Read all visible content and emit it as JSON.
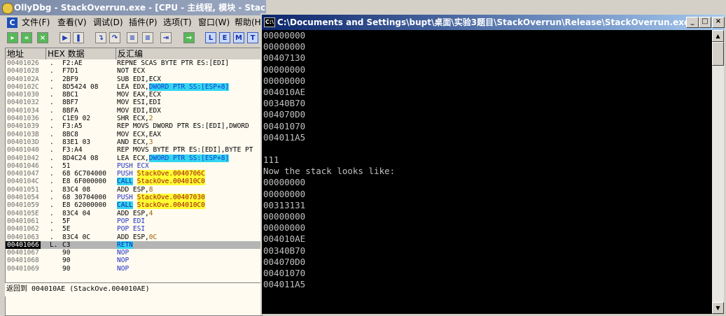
{
  "olly": {
    "title": "OllyDbg - StackOverrun.exe - [CPU - 主线程, 模块 - StackOve]",
    "menu": [
      "文件(F)",
      "查看(V)",
      "调试(D)",
      "插件(P)",
      "选项(T)",
      "窗口(W)",
      "帮助(H)"
    ],
    "menu_c": "C",
    "toolbar_letters": [
      "L",
      "E",
      "M",
      "T"
    ],
    "header": {
      "addr": "地址",
      "hex": "HEX 数据",
      "dis": "反汇编"
    },
    "rows": [
      {
        "addr": "00401026",
        "mark": ".",
        "hex": "F2:AE",
        "dis": [
          {
            "t": "REPNE SCAS BYTE PTR ES:[EDI]"
          }
        ]
      },
      {
        "addr": "00401028",
        "mark": ".",
        "hex": "F7D1",
        "dis": [
          {
            "t": "NOT ECX"
          }
        ]
      },
      {
        "addr": "0040102A",
        "mark": ".",
        "hex": "2BF9",
        "dis": [
          {
            "t": "SUB EDI,ECX"
          }
        ]
      },
      {
        "addr": "0040102C",
        "mark": ".",
        "hex": "8D5424 08",
        "dis": [
          {
            "t": "LEA EDX,"
          },
          {
            "t": "DWORD PTR SS:[ESP+8]",
            "c": "hl-cyan"
          }
        ]
      },
      {
        "addr": "00401030",
        "mark": ".",
        "hex": "8BC1",
        "dis": [
          {
            "t": "MOV EAX,ECX"
          }
        ]
      },
      {
        "addr": "00401032",
        "mark": ".",
        "hex": "8BF7",
        "dis": [
          {
            "t": "MOV ESI,EDI"
          }
        ]
      },
      {
        "addr": "00401034",
        "mark": ".",
        "hex": "8BFA",
        "dis": [
          {
            "t": "MOV EDI,EDX"
          }
        ]
      },
      {
        "addr": "00401036",
        "mark": ".",
        "hex": "C1E9 02",
        "dis": [
          {
            "t": "SHR ECX,"
          },
          {
            "t": "2",
            "c": "num"
          }
        ]
      },
      {
        "addr": "00401039",
        "mark": ".",
        "hex": "F3:A5",
        "dis": [
          {
            "t": "REP MOVS DWORD PTR ES:[EDI],DWORD"
          }
        ]
      },
      {
        "addr": "0040103B",
        "mark": ".",
        "hex": "8BC8",
        "dis": [
          {
            "t": "MOV ECX,EAX"
          }
        ]
      },
      {
        "addr": "0040103D",
        "mark": ".",
        "hex": "83E1 03",
        "dis": [
          {
            "t": "AND ECX,"
          },
          {
            "t": "3",
            "c": "num"
          }
        ]
      },
      {
        "addr": "00401040",
        "mark": ".",
        "hex": "F3:A4",
        "dis": [
          {
            "t": "REP MOVS BYTE PTR ES:[EDI],BYTE PT"
          }
        ]
      },
      {
        "addr": "00401042",
        "mark": ".",
        "hex": "8D4C24 08",
        "dis": [
          {
            "t": "LEA ECX,"
          },
          {
            "t": "DWORD PTR SS:[ESP+8]",
            "c": "hl-cyan"
          }
        ]
      },
      {
        "addr": "00401046",
        "mark": ".",
        "hex": "51",
        "dis": [
          {
            "t": "PUSH ECX",
            "c": "kw-push"
          }
        ]
      },
      {
        "addr": "00401047",
        "mark": ".",
        "hex": "68 6C704000",
        "dis": [
          {
            "t": "PUSH ",
            "c": "kw-push"
          },
          {
            "t": "StackOve.0040706C",
            "c": "hl-yellow"
          }
        ]
      },
      {
        "addr": "0040104C",
        "mark": ".",
        "hex": "E8 6F000000",
        "dis": [
          {
            "t": "CALL",
            "c": "kw-call"
          },
          {
            "t": " "
          },
          {
            "t": "StackOve.004010C0",
            "c": "hl-yellow"
          }
        ]
      },
      {
        "addr": "00401051",
        "mark": ".",
        "hex": "83C4 08",
        "dis": [
          {
            "t": "ADD ESP,"
          },
          {
            "t": "8",
            "c": "num"
          }
        ]
      },
      {
        "addr": "00401054",
        "mark": ".",
        "hex": "68 30704000",
        "dis": [
          {
            "t": "PUSH ",
            "c": "kw-push"
          },
          {
            "t": "StackOve.00407030",
            "c": "hl-yellow"
          }
        ]
      },
      {
        "addr": "00401059",
        "mark": ".",
        "hex": "E8 62000000",
        "dis": [
          {
            "t": "CALL",
            "c": "kw-call"
          },
          {
            "t": " "
          },
          {
            "t": "StackOve.004010C0",
            "c": "hl-yellow"
          }
        ]
      },
      {
        "addr": "0040105E",
        "mark": ".",
        "hex": "83C4 04",
        "dis": [
          {
            "t": "ADD ESP,"
          },
          {
            "t": "4",
            "c": "num"
          }
        ]
      },
      {
        "addr": "00401061",
        "mark": ".",
        "hex": "5F",
        "dis": [
          {
            "t": "POP EDI",
            "c": "kw-push"
          }
        ]
      },
      {
        "addr": "00401062",
        "mark": ".",
        "hex": "5E",
        "dis": [
          {
            "t": "POP ESI",
            "c": "kw-push"
          }
        ]
      },
      {
        "addr": "00401063",
        "mark": ".",
        "hex": "83C4 0C",
        "dis": [
          {
            "t": "ADD ESP,"
          },
          {
            "t": "0C",
            "c": "num"
          }
        ]
      },
      {
        "addr": "00401066",
        "mark": "L.",
        "hex": "C3",
        "dis": [
          {
            "t": "RETN",
            "c": "kw-retn"
          }
        ],
        "current": true
      },
      {
        "addr": "00401067",
        "mark": "",
        "hex": "90",
        "dis": [
          {
            "t": "NOP",
            "c": "kw-push"
          }
        ]
      },
      {
        "addr": "00401068",
        "mark": "",
        "hex": "90",
        "dis": [
          {
            "t": "NOP",
            "c": "kw-push"
          }
        ]
      },
      {
        "addr": "00401069",
        "mark": "",
        "hex": "90",
        "dis": [
          {
            "t": "NOP",
            "c": "kw-push"
          }
        ]
      }
    ],
    "status": "返回到 004010AE (StackOve.004010AE)"
  },
  "console": {
    "title": "C:\\Documents and Settings\\bupt\\桌面\\实验3题目\\StackOverrun\\Release\\StackOverrun.exe",
    "lines": [
      "00000000",
      "00000000",
      "00407130",
      "00000000",
      "00000000",
      "004010AE",
      "00340B70",
      "004070D0",
      "00401070",
      "004011A5",
      "",
      "111",
      "Now the stack looks like:",
      "00000000",
      "00000000",
      "00313131",
      "00000000",
      "00000000",
      "004010AE",
      "00340B70",
      "004070D0",
      "00401070",
      "004011A5"
    ]
  },
  "colors": {
    "olly_title": "#7b8ba8",
    "console_title": "#0a246a",
    "highlight_cyan": "#33d6f0",
    "highlight_yellow": "#ffff33"
  }
}
